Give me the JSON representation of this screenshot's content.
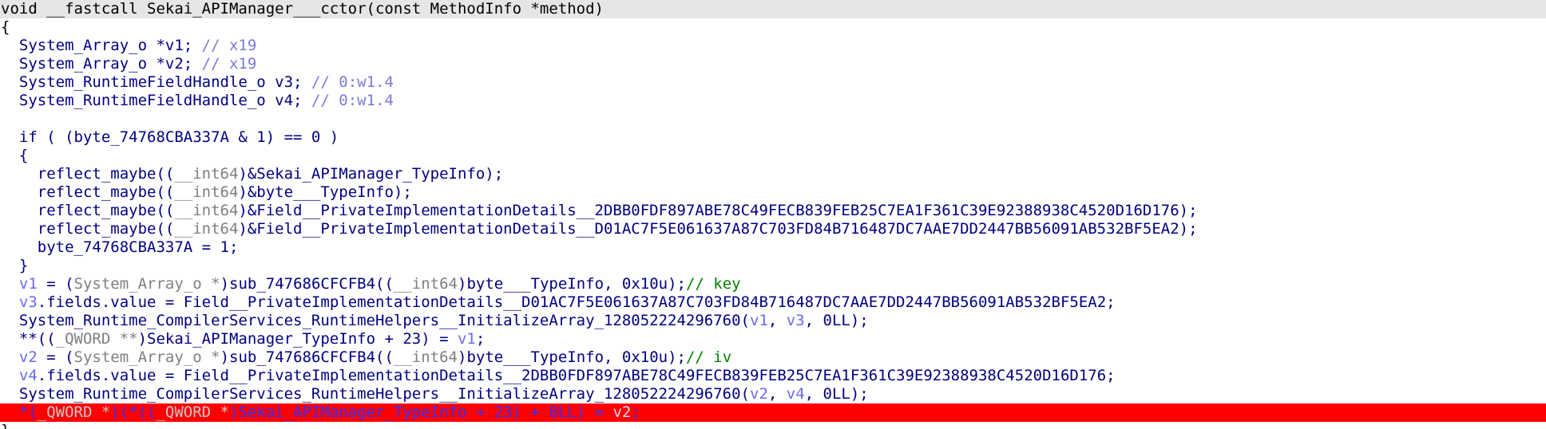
{
  "code_view": {
    "lines": [
      {
        "style": "header",
        "tokens": [
          {
            "t": "void __fastcall Sekai_APIManager___cctor(const MethodInfo *method)",
            "c": "black"
          }
        ]
      },
      {
        "style": "",
        "tokens": [
          {
            "t": "{",
            "c": "black"
          }
        ]
      },
      {
        "style": "",
        "tokens": [
          {
            "t": "  System_Array_o *v1; ",
            "c": "default"
          },
          {
            "t": "// x19",
            "c": "comment"
          }
        ]
      },
      {
        "style": "",
        "tokens": [
          {
            "t": "  System_Array_o *v2; ",
            "c": "default"
          },
          {
            "t": "// x19",
            "c": "comment"
          }
        ]
      },
      {
        "style": "",
        "tokens": [
          {
            "t": "  System_RuntimeFieldHandle_o v3; ",
            "c": "default"
          },
          {
            "t": "// 0:w1.4",
            "c": "comment"
          }
        ]
      },
      {
        "style": "",
        "tokens": [
          {
            "t": "  System_RuntimeFieldHandle_o v4; ",
            "c": "default"
          },
          {
            "t": "// 0:w1.4",
            "c": "comment"
          }
        ]
      },
      {
        "style": "",
        "tokens": [
          {
            "t": " ",
            "c": "default"
          }
        ]
      },
      {
        "style": "",
        "tokens": [
          {
            "t": "  if ( (byte_74768CBA337A & 1) == 0 )",
            "c": "default"
          }
        ]
      },
      {
        "style": "",
        "tokens": [
          {
            "t": "  {",
            "c": "default"
          }
        ]
      },
      {
        "style": "",
        "tokens": [
          {
            "t": "    reflect_maybe((",
            "c": "default"
          },
          {
            "t": "__int64",
            "c": "gray"
          },
          {
            "t": ")&Sekai_APIManager_TypeInfo);",
            "c": "default"
          }
        ]
      },
      {
        "style": "",
        "tokens": [
          {
            "t": "    reflect_maybe((",
            "c": "default"
          },
          {
            "t": "__int64",
            "c": "gray"
          },
          {
            "t": ")&byte___TypeInfo);",
            "c": "default"
          }
        ]
      },
      {
        "style": "",
        "tokens": [
          {
            "t": "    reflect_maybe((",
            "c": "default"
          },
          {
            "t": "__int64",
            "c": "gray"
          },
          {
            "t": ")&Field__PrivateImplementationDetails__2DBB0FDF897ABE78C49FECB839FEB25C7EA1F361C39E92388938C4520D16D176);",
            "c": "default"
          }
        ]
      },
      {
        "style": "",
        "tokens": [
          {
            "t": "    reflect_maybe((",
            "c": "default"
          },
          {
            "t": "__int64",
            "c": "gray"
          },
          {
            "t": ")&Field__PrivateImplementationDetails__D01AC7F5E061637A87C703FD84B716487DC7AAE7DD2447BB56091AB532BF5EA2);",
            "c": "default"
          }
        ]
      },
      {
        "style": "",
        "tokens": [
          {
            "t": "    byte_74768CBA337A = 1;",
            "c": "default"
          }
        ]
      },
      {
        "style": "",
        "tokens": [
          {
            "t": "  }",
            "c": "default"
          }
        ]
      },
      {
        "style": "",
        "tokens": [
          {
            "t": "  ",
            "c": "default"
          },
          {
            "t": "v1",
            "c": "var"
          },
          {
            "t": " = (",
            "c": "default"
          },
          {
            "t": "System_Array_o *",
            "c": "gray"
          },
          {
            "t": ")sub_747686CFCFB4((",
            "c": "default"
          },
          {
            "t": "__int64",
            "c": "gray"
          },
          {
            "t": ")byte___TypeInfo, 0x10u);",
            "c": "default"
          },
          {
            "t": "// key",
            "c": "green"
          }
        ]
      },
      {
        "style": "",
        "tokens": [
          {
            "t": "  ",
            "c": "default"
          },
          {
            "t": "v3",
            "c": "var"
          },
          {
            "t": ".fields.value = Field__PrivateImplementationDetails__D01AC7F5E061637A87C703FD84B716487DC7AAE7DD2447BB56091AB532BF5EA2;",
            "c": "default"
          }
        ]
      },
      {
        "style": "",
        "tokens": [
          {
            "t": "  System_Runtime_CompilerServices_RuntimeHelpers__InitializeArray_128052224296760(",
            "c": "default"
          },
          {
            "t": "v1",
            "c": "var"
          },
          {
            "t": ", ",
            "c": "default"
          },
          {
            "t": "v3",
            "c": "var"
          },
          {
            "t": ", 0LL);",
            "c": "default"
          }
        ]
      },
      {
        "style": "",
        "tokens": [
          {
            "t": "  **((",
            "c": "default"
          },
          {
            "t": "_QWORD **",
            "c": "gray"
          },
          {
            "t": ")Sekai_APIManager_TypeInfo + 23) = ",
            "c": "default"
          },
          {
            "t": "v1",
            "c": "var"
          },
          {
            "t": ";",
            "c": "default"
          }
        ]
      },
      {
        "style": "",
        "tokens": [
          {
            "t": "  ",
            "c": "default"
          },
          {
            "t": "v2",
            "c": "var"
          },
          {
            "t": " = (",
            "c": "default"
          },
          {
            "t": "System_Array_o *",
            "c": "gray"
          },
          {
            "t": ")sub_747686CFCFB4((",
            "c": "default"
          },
          {
            "t": "__int64",
            "c": "gray"
          },
          {
            "t": ")byte___TypeInfo, 0x10u);",
            "c": "default"
          },
          {
            "t": "// iv",
            "c": "green"
          }
        ]
      },
      {
        "style": "",
        "tokens": [
          {
            "t": "  ",
            "c": "default"
          },
          {
            "t": "v4",
            "c": "var"
          },
          {
            "t": ".fields.value = Field__PrivateImplementationDetails__2DBB0FDF897ABE78C49FECB839FEB25C7EA1F361C39E92388938C4520D16D176;",
            "c": "default"
          }
        ]
      },
      {
        "style": "",
        "tokens": [
          {
            "t": "  System_Runtime_CompilerServices_RuntimeHelpers__InitializeArray_128052224296760(",
            "c": "default"
          },
          {
            "t": "v2",
            "c": "var"
          },
          {
            "t": ", ",
            "c": "default"
          },
          {
            "t": "v4",
            "c": "var"
          },
          {
            "t": ", 0LL);",
            "c": "default"
          }
        ]
      },
      {
        "style": "highlight",
        "tokens": [
          {
            "t": "  *(",
            "c": "default"
          },
          {
            "t": "_QWORD *",
            "c": "gray"
          },
          {
            "t": ")(*((",
            "c": "default"
          },
          {
            "t": "_QWORD *",
            "c": "gray"
          },
          {
            "t": ")Sekai_APIManager_TypeInfo + 23) + 8LL) = ",
            "c": "default"
          },
          {
            "t": "v2",
            "c": "var"
          },
          {
            "t": ";",
            "c": "default"
          }
        ]
      },
      {
        "style": "",
        "tokens": [
          {
            "t": "}",
            "c": "black"
          }
        ]
      }
    ]
  }
}
